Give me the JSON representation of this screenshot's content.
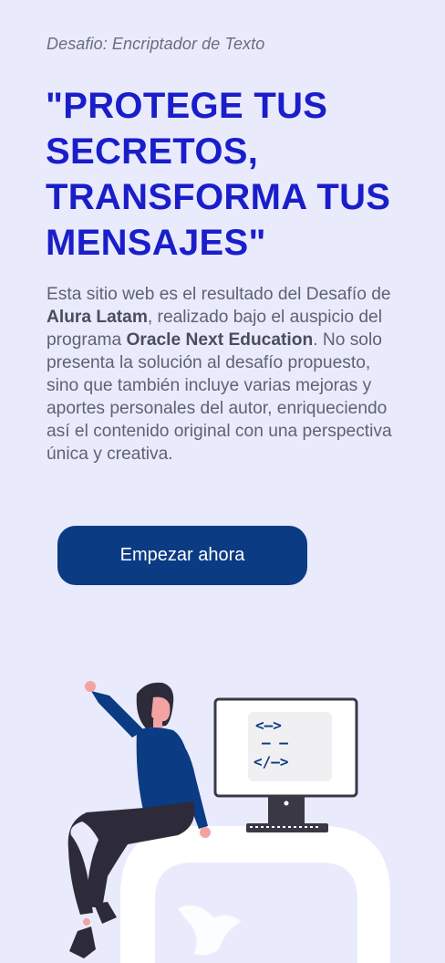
{
  "header": {
    "subtitle": "Desafio: Encriptador de Texto",
    "headline": "\"PROTEGE TUS SECRETOS, TRANSFORMA TUS MENSAJES\""
  },
  "description": {
    "part1": "Esta sitio web es el resultado del Desafío de ",
    "bold1": "Alura Latam",
    "part2": ", realizado bajo el auspicio del programa ",
    "bold2": "Oracle Next Education",
    "part3": ". No solo presenta la solución al desafío propuesto, sino que también incluye varias mejoras y aportes personales del autor, enriqueciendo así el contenido original con una perspectiva única y creativa."
  },
  "cta": {
    "label": "Empezar ahora"
  },
  "illustration": {
    "monitor_code_lines": [
      "<—>",
      "— —",
      "</—>"
    ],
    "colors": {
      "accent": "#1a1ec9",
      "button": "#0b3b83",
      "background": "#e9ebfd",
      "figure_shirt": "#0b3b83",
      "figure_pants": "#2d2a3a",
      "skin": "#f4a3a3"
    }
  }
}
